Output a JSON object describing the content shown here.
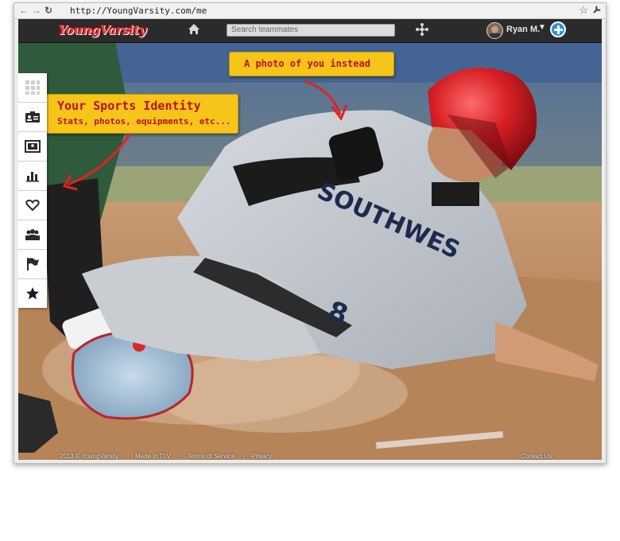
{
  "browser": {
    "url": "http://YoungVarsity.com/me",
    "nav_icons": [
      "back-icon",
      "forward-icon",
      "reload-icon"
    ],
    "right_icons": [
      "star-icon",
      "wrench-icon"
    ]
  },
  "topbar": {
    "logo": "YoungVarsity",
    "search_placeholder": "Search teammates",
    "user_name": "Ryan M.",
    "icons": [
      "home-icon",
      "network-icon",
      "avatar",
      "caret-down-icon",
      "plus-icon"
    ]
  },
  "sidebar": {
    "items": [
      {
        "icon": "grid-icon"
      },
      {
        "icon": "id-card-icon"
      },
      {
        "icon": "photo-icon"
      },
      {
        "icon": "stats-chart-icon"
      },
      {
        "icon": "heart-icon"
      },
      {
        "icon": "team-icon"
      },
      {
        "icon": "flag-icon"
      },
      {
        "icon": "star-icon"
      }
    ]
  },
  "callouts": {
    "photo": "A photo of you instead",
    "identity_title": "Your Sports Identity",
    "identity_sub": "Stats, photos, equipments, etc..."
  },
  "footer": {
    "copyright": "2013 © YoungVarsity",
    "made_in": "Made in TLV",
    "terms": "Terms of Service",
    "privacy": "Privacy",
    "contact": "Contact Us"
  },
  "colors": {
    "topbar": "#2b2b2b",
    "callout_bg": "#f6c51a",
    "callout_text": "#c0101a",
    "arrow": "#e02222",
    "add_button": "#2f8fe0"
  }
}
